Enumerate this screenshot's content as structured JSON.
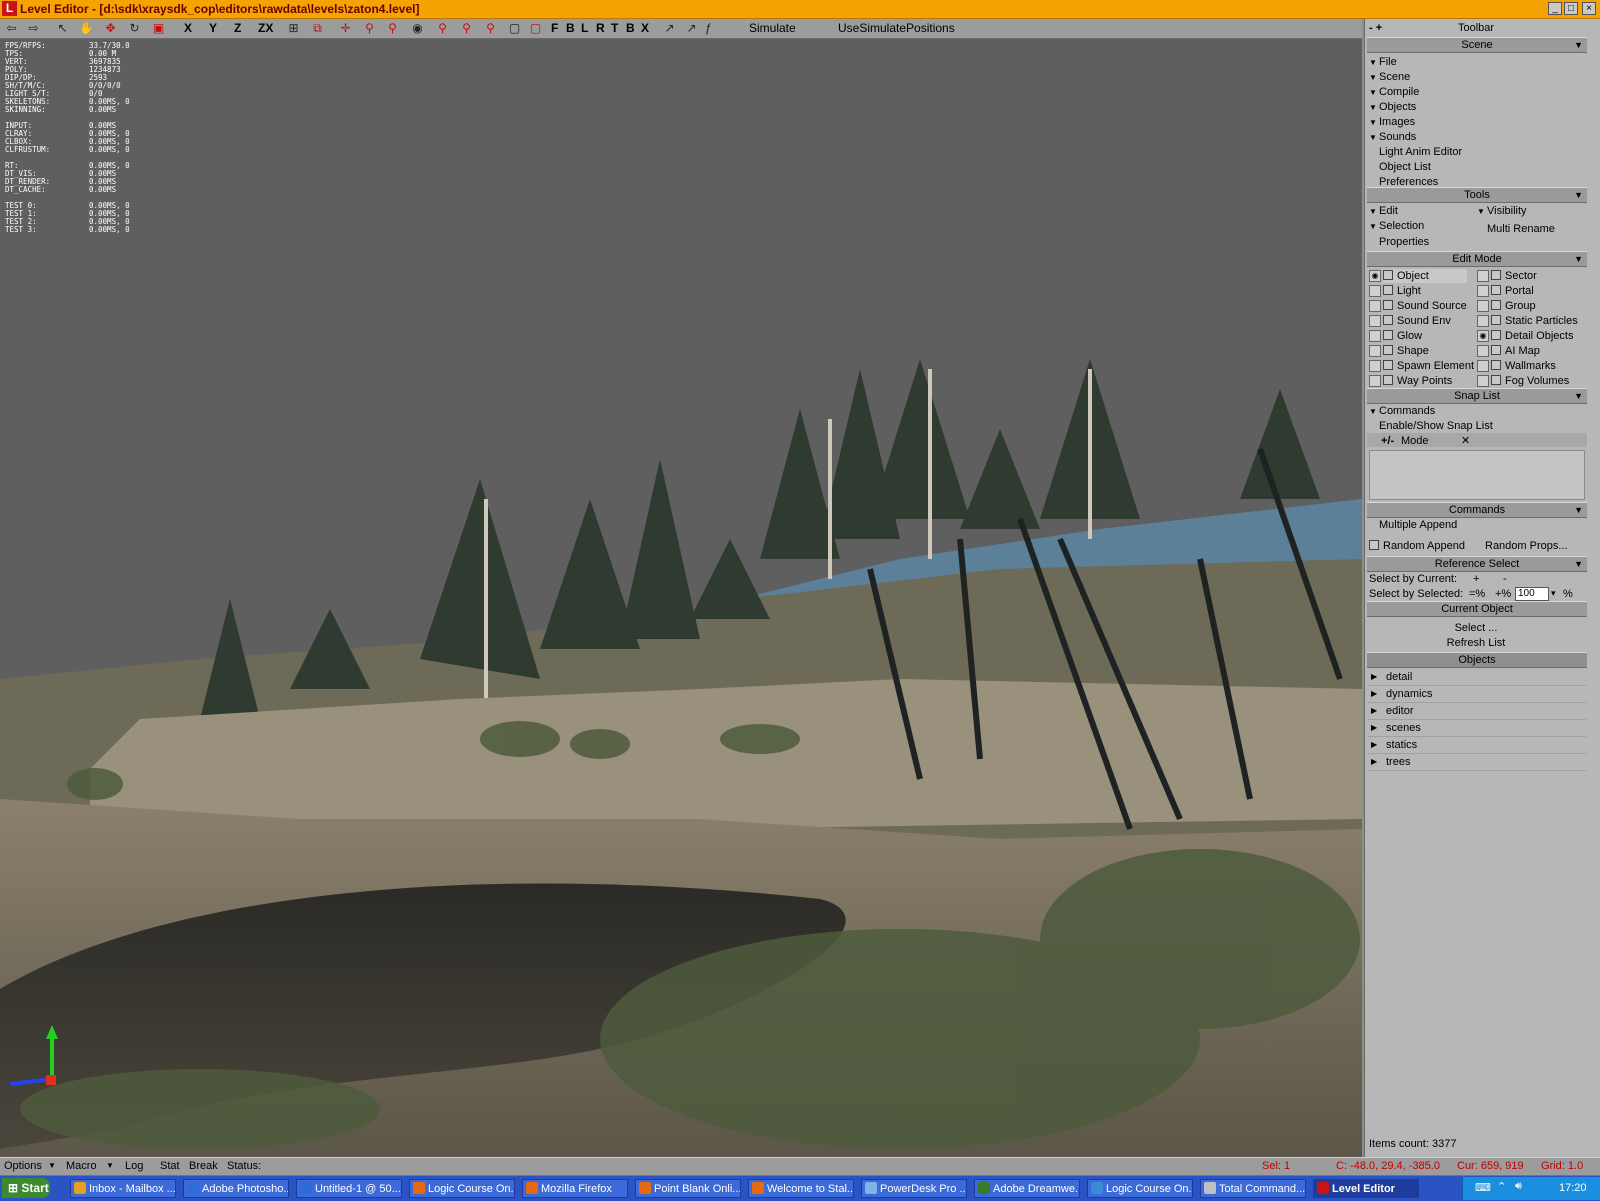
{
  "window": {
    "app_icon": "L",
    "title": "Level Editor - [d:\\sdk\\xraysdk_cop\\editors\\rawdata\\levels\\zaton4.level]",
    "controls": [
      "_",
      "□",
      "×"
    ]
  },
  "toolbar": {
    "icons": [
      "arrow-left-icon",
      "arrow-right-icon",
      "select-arrow-icon",
      "pick-icon",
      "move-icon",
      "rotate-icon",
      "scale-icon"
    ],
    "axis_letters": [
      "X",
      "Y",
      "Z",
      "ZX"
    ],
    "view_letters": [
      "F",
      "B",
      "L",
      "R",
      "T",
      "B",
      "X"
    ],
    "simulate_label": "Simulate",
    "use_simulate_label": "UseSimulatePositions"
  },
  "stats": [
    {
      "k": "FPS/RFPS:",
      "v": "33.7/30.0"
    },
    {
      "k": "TPS:",
      "v": "0.00 M"
    },
    {
      "k": "VERT:",
      "v": "3697835"
    },
    {
      "k": "POLY:",
      "v": "1234873"
    },
    {
      "k": "DIP/DP:",
      "v": "2593"
    },
    {
      "k": "SH/T/M/C:",
      "v": "0/0/0/0"
    },
    {
      "k": "LIGHT S/T:",
      "v": "0/0"
    },
    {
      "k": "SKELETONS:",
      "v": "0.00MS,  0"
    },
    {
      "k": "SKINNING:",
      "v": "0.00MS"
    },
    {
      "k": "INPUT:",
      "v": "0.00MS",
      "gap": true
    },
    {
      "k": "CLRAY:",
      "v": "0.00MS,  0"
    },
    {
      "k": "CLBOX:",
      "v": "0.00MS,  0"
    },
    {
      "k": "CLFRUSTUM:",
      "v": "0.00MS,  0"
    },
    {
      "k": " RT:",
      "v": "0.00MS,  0",
      "gap": true
    },
    {
      "k": " DT_VIS:",
      "v": "0.00MS"
    },
    {
      "k": " DT_RENDER:",
      "v": "0.00MS"
    },
    {
      "k": " DT_CACHE:",
      "v": "0.00MS"
    },
    {
      "k": "TEST 0:",
      "v": "0.00MS,  0",
      "gap": true
    },
    {
      "k": "TEST 1:",
      "v": "0.00MS,  0"
    },
    {
      "k": "TEST 2:",
      "v": "0.00MS,  0"
    },
    {
      "k": "TEST 3:",
      "v": "0.00MS,  0"
    }
  ],
  "panel": {
    "toolbar_header": "Toolbar",
    "toolbar_minus": "- +",
    "scene_header": "Scene",
    "scene_items": [
      {
        "label": "File",
        "tri": "▼"
      },
      {
        "label": "Scene",
        "tri": "▼"
      },
      {
        "label": "Compile",
        "tri": "▼"
      },
      {
        "label": "Objects",
        "tri": "▼"
      },
      {
        "label": "Images",
        "tri": "▼"
      },
      {
        "label": "Sounds",
        "tri": "▼"
      },
      {
        "label": "Light Anim Editor",
        "tri": ""
      },
      {
        "label": "Object List",
        "tri": ""
      },
      {
        "label": "Preferences",
        "tri": ""
      }
    ],
    "tools_header": "Tools",
    "tools_edit": "Edit",
    "tools_selection": "Selection",
    "tools_properties": "Properties",
    "tools_visibility": "Visibility",
    "tools_multi_rename": "Multi Rename",
    "edit_mode_header": "Edit Mode",
    "edit_left": [
      "Object",
      "Light",
      "Sound Source",
      "Sound Env",
      "Glow",
      "Shape",
      "Spawn Element",
      "Way Points"
    ],
    "edit_right": [
      "Sector",
      "Portal",
      "Group",
      "Static Particles",
      "Detail Objects",
      "AI Map",
      "Wallmarks",
      "Fog Volumes"
    ],
    "snap_header": "Snap List",
    "snap_commands": "Commands",
    "snap_enable": "Enable/Show Snap List",
    "snap_mode_pm": "+/-",
    "snap_mode": "Mode",
    "snap_x": "✕",
    "commands_header": "Commands",
    "multiple_append": "Multiple Append",
    "random_append": "Random Append",
    "random_props": "Random Props...",
    "ref_select_header": "Reference Select",
    "select_by_current": "Select by Current:",
    "sel_cur_plus": "+",
    "sel_cur_minus": "-",
    "select_by_selected": "Select by Selected:",
    "sel_sel_eq": "=%",
    "sel_sel_plus": "+%",
    "sel_sel_value": "100",
    "sel_sel_pct": "%",
    "current_object_header": "Current Object",
    "select_btn": "Select ...",
    "refresh_list": "Refresh List",
    "objects_header": "Objects",
    "objects": [
      "detail",
      "dynamics",
      "editor",
      "scenes",
      "statics",
      "trees"
    ],
    "items_count": "Items count: 3377"
  },
  "statusbar": {
    "options": "Options",
    "macro": "Macro",
    "log": "Log",
    "stat": "Stat",
    "break": "Break",
    "status": "Status:",
    "sel": "Sel: 1",
    "coords": "C: -48.0, 29.4, -385.0",
    "cursor": "Cur: 659, 919",
    "grid": "Grid: 1.0"
  },
  "taskbar": {
    "start": "Start",
    "tasks": [
      {
        "label": "Inbox - Mailbox ...",
        "color": "#e8a020"
      },
      {
        "label": "Adobe Photosho...",
        "color": "#2d6bd6"
      },
      {
        "label": "Untitled-1 @ 50...",
        "color": "#2d6bd6"
      },
      {
        "label": "Logic Course On...",
        "color": "#e86a10"
      },
      {
        "label": "Mozilla Firefox",
        "color": "#e86a10"
      },
      {
        "label": "Point Blank Onli...",
        "color": "#e86a10"
      },
      {
        "label": "Welcome to Stal...",
        "color": "#e86a10"
      },
      {
        "label": "PowerDesk Pro ...",
        "color": "#7fb3e8"
      },
      {
        "label": "Adobe Dreamwe...",
        "color": "#3a7a2a"
      },
      {
        "label": "Logic Course On...",
        "color": "#3a8ad6"
      },
      {
        "label": "Total Command...",
        "color": "#c0c0c0"
      },
      {
        "label": "Level Editor",
        "color": "#c81414",
        "active": true
      }
    ],
    "clock": "17:20"
  }
}
